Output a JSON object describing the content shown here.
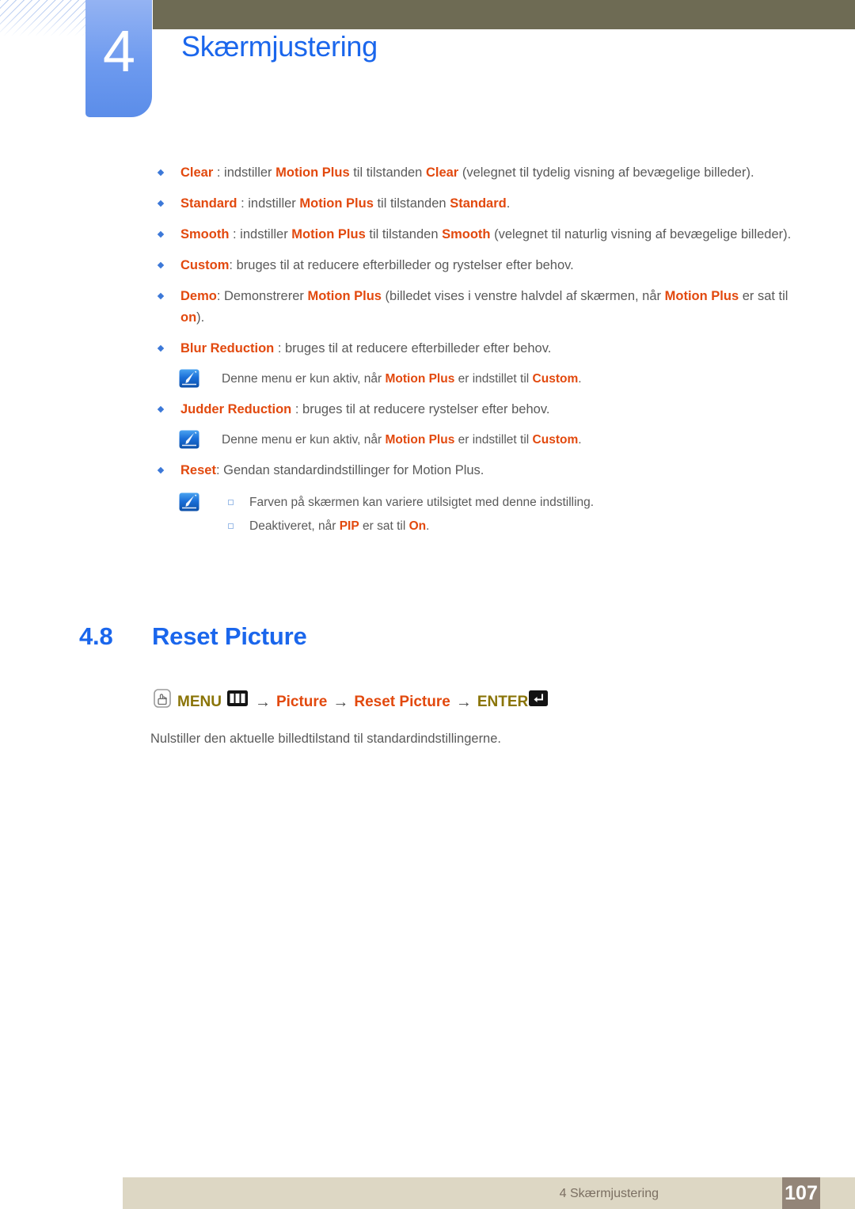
{
  "header": {
    "chapter_number": "4",
    "chapter_title": "Skærmjustering",
    "accent_blue": "#1a66ec",
    "tab_blue": "#6d9aef",
    "olive": "#6e6b54"
  },
  "bullets": [
    {
      "id": "clear",
      "parts": [
        {
          "text": "Clear",
          "style": "highlight"
        },
        {
          "text": " : indstiller ",
          "style": "plain"
        },
        {
          "text": "Motion Plus",
          "style": "highlight"
        },
        {
          "text": " til tilstanden ",
          "style": "plain"
        },
        {
          "text": "Clear",
          "style": "highlight"
        },
        {
          "text": " (velegnet til tydelig visning af bevægelige billeder).",
          "style": "plain"
        }
      ]
    },
    {
      "id": "standard",
      "parts": [
        {
          "text": "Standard",
          "style": "highlight"
        },
        {
          "text": " : indstiller ",
          "style": "plain"
        },
        {
          "text": "Motion Plus",
          "style": "highlight"
        },
        {
          "text": " til tilstanden ",
          "style": "plain"
        },
        {
          "text": "Standard",
          "style": "highlight"
        },
        {
          "text": ".",
          "style": "plain"
        }
      ]
    },
    {
      "id": "smooth",
      "parts": [
        {
          "text": "Smooth",
          "style": "highlight"
        },
        {
          "text": " : indstiller ",
          "style": "plain"
        },
        {
          "text": "Motion Plus",
          "style": "highlight"
        },
        {
          "text": " til tilstanden ",
          "style": "plain"
        },
        {
          "text": "Smooth",
          "style": "highlight"
        },
        {
          "text": " (velegnet til naturlig visning af bevægelige billeder).",
          "style": "plain"
        }
      ]
    },
    {
      "id": "custom",
      "parts": [
        {
          "text": "Custom",
          "style": "highlight"
        },
        {
          "text": ": bruges til at reducere efterbilleder og rystelser efter behov.",
          "style": "plain"
        }
      ]
    },
    {
      "id": "demo",
      "parts": [
        {
          "text": "Demo",
          "style": "highlight"
        },
        {
          "text": ": Demonstrerer ",
          "style": "plain"
        },
        {
          "text": "Motion Plus",
          "style": "highlight"
        },
        {
          "text": " (billedet vises i venstre halvdel af skærmen, når ",
          "style": "plain"
        },
        {
          "text": "Motion Plus",
          "style": "highlight"
        },
        {
          "text": " er sat til ",
          "style": "plain"
        },
        {
          "text": "on",
          "style": "highlight"
        },
        {
          "text": ").",
          "style": "plain"
        }
      ]
    },
    {
      "id": "blur-reduction",
      "parts": [
        {
          "text": "Blur Reduction",
          "style": "highlight"
        },
        {
          "text": " : bruges til at reducere efterbilleder efter behov.",
          "style": "plain"
        }
      ]
    }
  ],
  "note_blur": {
    "icon": "note-pen-icon",
    "parts": [
      {
        "text": "Denne menu er kun aktiv, når ",
        "style": "plain"
      },
      {
        "text": "Motion Plus",
        "style": "highlight"
      },
      {
        "text": " er indstillet til ",
        "style": "plain"
      },
      {
        "text": "Custom",
        "style": "highlight"
      },
      {
        "text": ".",
        "style": "plain"
      }
    ]
  },
  "bullet_judder": {
    "id": "judder-reduction",
    "parts": [
      {
        "text": "Judder Reduction",
        "style": "highlight"
      },
      {
        "text": " : bruges til at reducere rystelser efter behov.",
        "style": "plain"
      }
    ]
  },
  "note_judder": {
    "icon": "note-pen-icon",
    "parts": [
      {
        "text": "Denne menu er kun aktiv, når ",
        "style": "plain"
      },
      {
        "text": "Motion Plus",
        "style": "highlight"
      },
      {
        "text": " er indstillet til ",
        "style": "plain"
      },
      {
        "text": "Custom",
        "style": "highlight"
      },
      {
        "text": ".",
        "style": "plain"
      }
    ]
  },
  "bullet_reset": {
    "id": "reset",
    "parts": [
      {
        "text": "Reset",
        "style": "highlight"
      },
      {
        "text": ": Gendan standardindstillinger for Motion Plus.",
        "style": "plain"
      }
    ]
  },
  "note_reset": {
    "icon": "note-pen-icon",
    "lines": [
      {
        "parts": [
          {
            "text": "Farven på skærmen kan variere utilsigtet med denne indstilling.",
            "style": "plain"
          }
        ]
      },
      {
        "parts": [
          {
            "text": "Deaktiveret, når ",
            "style": "plain"
          },
          {
            "text": "PIP",
            "style": "highlight"
          },
          {
            "text": " er sat til ",
            "style": "plain"
          },
          {
            "text": "On",
            "style": "highlight"
          },
          {
            "text": ".",
            "style": "plain"
          }
        ]
      }
    ]
  },
  "section": {
    "number": "4.8",
    "title": "Reset Picture"
  },
  "menu_path": {
    "hand_icon": "press-button-icon",
    "menu_label": "MENU",
    "menu_button_icon": "menu-button-icon",
    "arrow": "→",
    "step1": "Picture",
    "step2": "Reset Picture",
    "enter_label": "ENTER",
    "enter_icon": "enter-key-icon",
    "gold_color": "#8a7407",
    "orange_color": "#e2490e"
  },
  "description": "Nulstiller den aktuelle billedtilstand til standardindstillingerne.",
  "footer": {
    "chapter_text": "4 Skærmjustering",
    "page_number": "107",
    "bar_color": "#ddd7c4",
    "page_box_color": "#938578"
  }
}
